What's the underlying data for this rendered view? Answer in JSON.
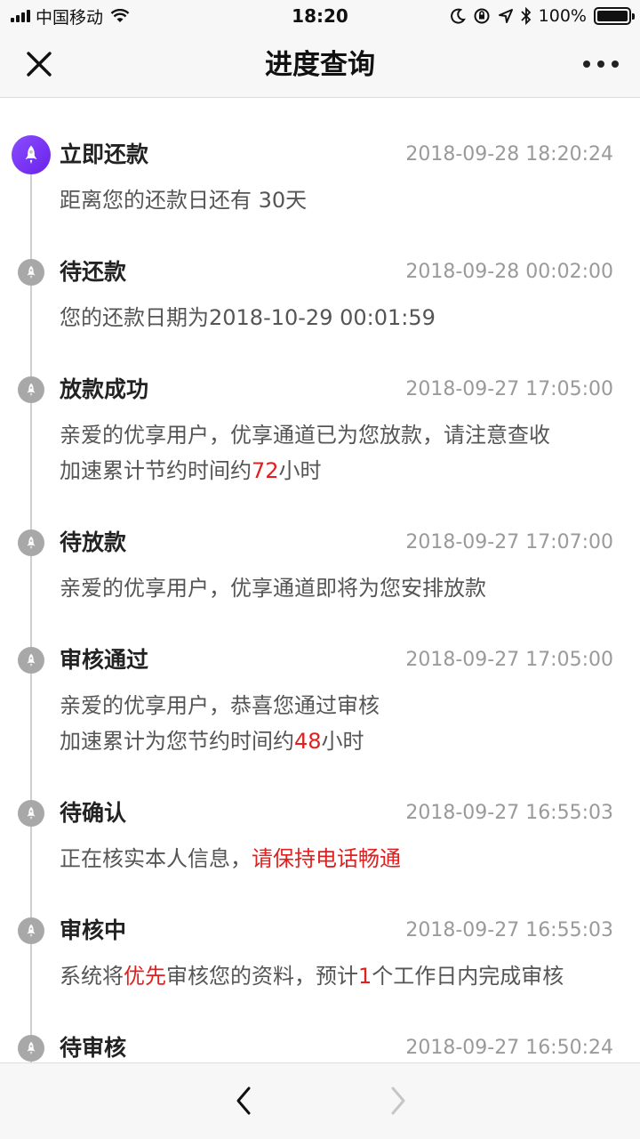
{
  "status_bar": {
    "carrier": "中国移动",
    "time": "18:20",
    "battery": "100%"
  },
  "nav": {
    "title": "进度查询",
    "close_icon": "close-icon",
    "more_icon": "more-icon"
  },
  "timeline": [
    {
      "title": "立即还款",
      "time": "2018-09-28 18:20:24",
      "lines": [
        [
          {
            "t": "距离您的还款日还有 30天"
          }
        ]
      ],
      "active": true
    },
    {
      "title": "待还款",
      "time": "2018-09-28 00:02:00",
      "lines": [
        [
          {
            "t": "您的还款日期为2018-10-29 00:01:59"
          }
        ]
      ]
    },
    {
      "title": "放款成功",
      "time": "2018-09-27 17:05:00",
      "lines": [
        [
          {
            "t": "亲爱的优享用户，优享通道已为您放款，请注意查收"
          }
        ],
        [
          {
            "t": "加速累计节约时间约"
          },
          {
            "t": "72",
            "red": true
          },
          {
            "t": "小时"
          }
        ]
      ]
    },
    {
      "title": "待放款",
      "time": "2018-09-27 17:07:00",
      "lines": [
        [
          {
            "t": "亲爱的优享用户，优享通道即将为您安排放款"
          }
        ]
      ]
    },
    {
      "title": "审核通过",
      "time": "2018-09-27 17:05:00",
      "lines": [
        [
          {
            "t": "亲爱的优享用户，恭喜您通过审核"
          }
        ],
        [
          {
            "t": "加速累计为您节约时间约"
          },
          {
            "t": "48",
            "red": true
          },
          {
            "t": "小时"
          }
        ]
      ]
    },
    {
      "title": "待确认",
      "time": "2018-09-27 16:55:03",
      "lines": [
        [
          {
            "t": "正在核实本人信息，"
          },
          {
            "t": "请保持电话畅通",
            "red": true
          }
        ]
      ]
    },
    {
      "title": "审核中",
      "time": "2018-09-27 16:55:03",
      "lines": [
        [
          {
            "t": "系统将"
          },
          {
            "t": "优先",
            "red": true
          },
          {
            "t": "审核您的资料，预计"
          },
          {
            "t": "1",
            "red": true
          },
          {
            "t": "个工作日内完成审核"
          }
        ]
      ]
    },
    {
      "title": "待审核",
      "time": "2018-09-27 16:50:24",
      "lines": []
    }
  ],
  "toolbar": {
    "back_icon": "chevron-left-icon",
    "forward_icon": "chevron-right-icon"
  },
  "colors": {
    "accent_purple": "#7a35f2",
    "highlight_red": "#e02020",
    "timeline_gray": "#a8a8a8"
  }
}
